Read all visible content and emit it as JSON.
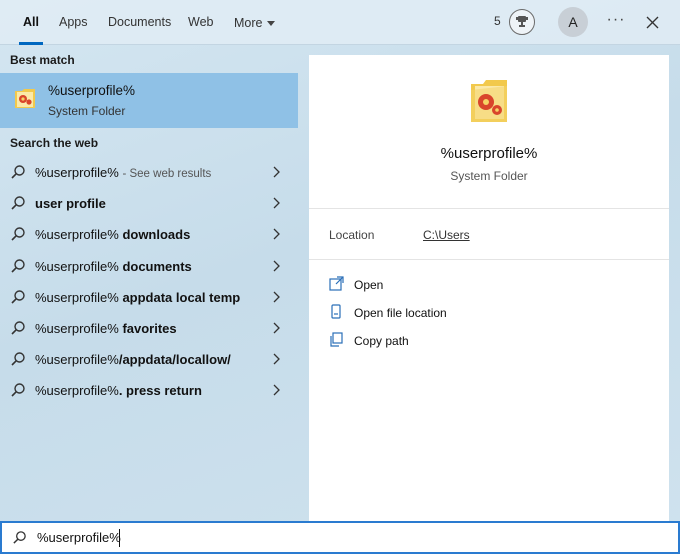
{
  "tabs": [
    {
      "label": "All",
      "active": true
    },
    {
      "label": "Apps",
      "active": false
    },
    {
      "label": "Documents",
      "active": false
    },
    {
      "label": "Web",
      "active": false
    },
    {
      "label": "More",
      "active": false
    }
  ],
  "header": {
    "points": "5",
    "avatar_initial": "A",
    "more_glyph": "···"
  },
  "best_match": {
    "heading": "Best match",
    "title": "%userprofile%",
    "subtitle": "System Folder",
    "icon": "folder-icon"
  },
  "web": {
    "heading": "Search the web",
    "see_results": "- See web results",
    "items": [
      {
        "prefix": "%userprofile%",
        "bold": ""
      },
      {
        "prefix": "",
        "bold": "user profile"
      },
      {
        "prefix": "%userprofile%",
        "bold": " downloads"
      },
      {
        "prefix": "%userprofile%",
        "bold": " documents"
      },
      {
        "prefix": "%userprofile%",
        "bold": " appdata local temp"
      },
      {
        "prefix": "%userprofile%",
        "bold": " favorites"
      },
      {
        "prefix": "%userprofile%",
        "bold": "/appdata/locallow/"
      },
      {
        "prefix": "%userprofile%",
        "bold": ". press return"
      }
    ]
  },
  "preview": {
    "title": "%userprofile%",
    "subtitle": "System Folder",
    "location_label": "Location",
    "location_value": "C:\\Users",
    "actions": [
      {
        "label": "Open",
        "icon": "open-window-icon"
      },
      {
        "label": "Open file location",
        "icon": "file-location-icon"
      },
      {
        "label": "Copy path",
        "icon": "copy-icon"
      }
    ]
  },
  "search": {
    "value": "%userprofile%"
  },
  "colors": {
    "accent": "#0067c0",
    "selected_bg": "#8fc1e6",
    "search_border": "#2a7bd0"
  }
}
